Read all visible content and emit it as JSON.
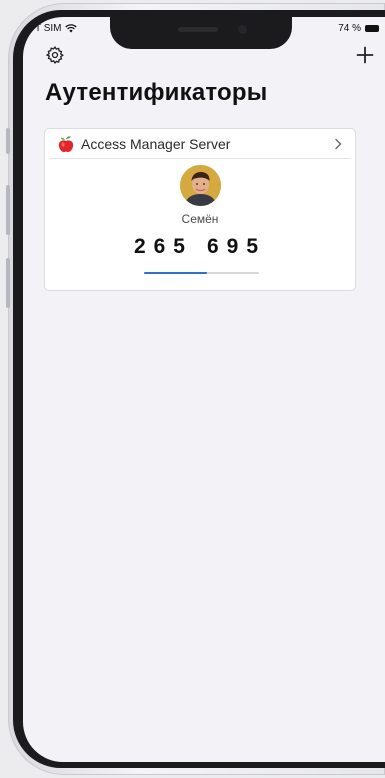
{
  "status_bar": {
    "carrier": "T SIM",
    "battery": "74 %"
  },
  "header": {
    "title": "Аутентификаторы",
    "settings_icon": "gear-icon",
    "add_icon": "plus-icon"
  },
  "authenticator": {
    "server_name": "Access Manager Server",
    "user_name": "Семён",
    "code_part1": "265",
    "code_part2": "695",
    "time_remaining_fraction": 0.55,
    "accent_color": "#2f6fcf"
  }
}
